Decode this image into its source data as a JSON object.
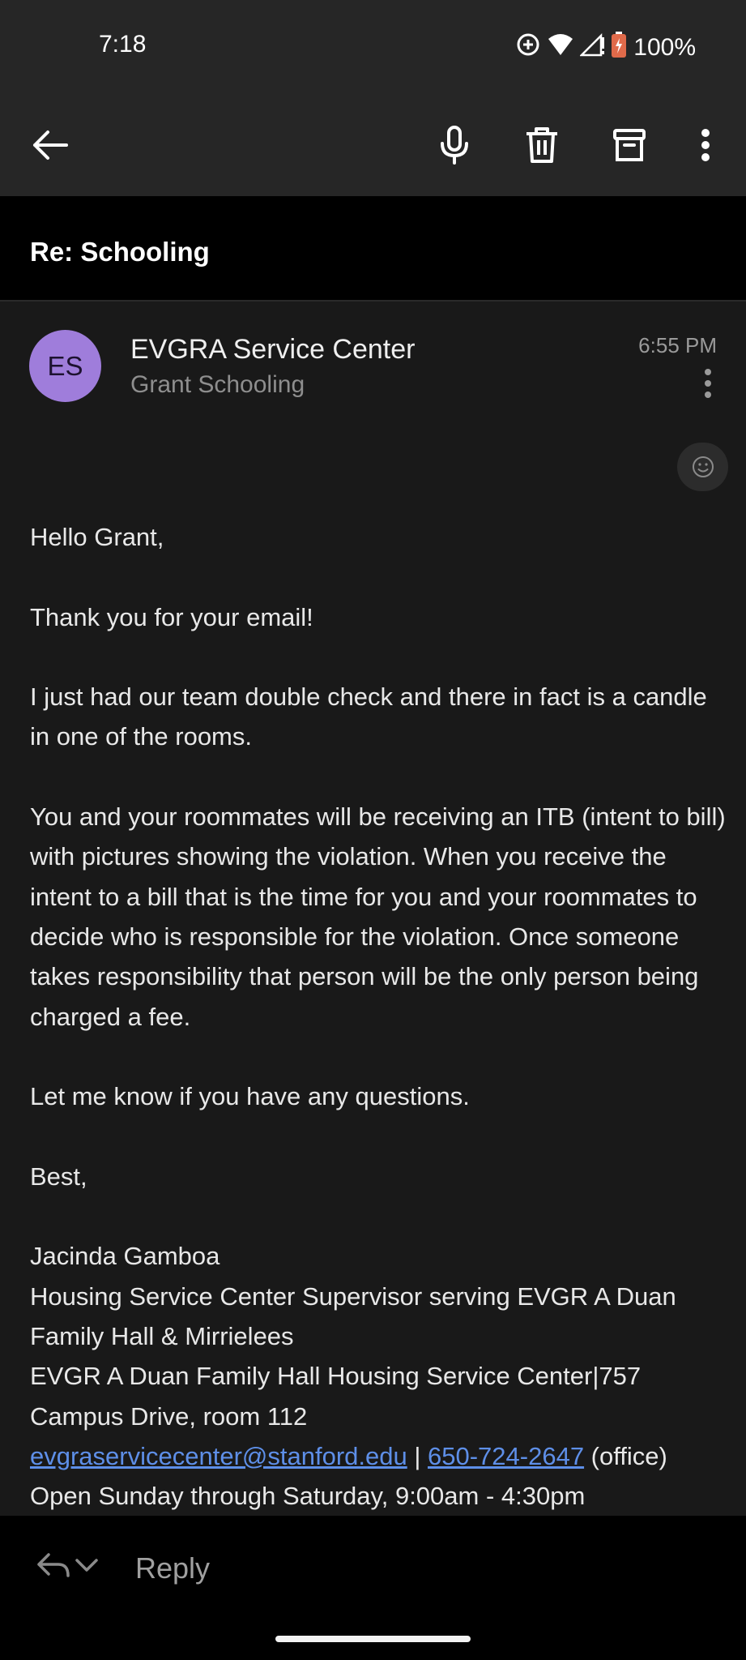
{
  "status_bar": {
    "time": "7:18",
    "battery": "100%",
    "icons": [
      "data-saver-icon",
      "wifi-icon",
      "signal-icon",
      "battery-icon"
    ]
  },
  "toolbar": {
    "icons": [
      "back-arrow-icon",
      "microphone-icon",
      "trash-icon",
      "archive-icon",
      "more-vert-icon"
    ]
  },
  "email": {
    "subject": "Re: Schooling",
    "avatar_initials": "ES",
    "avatar_color": "#9f7ddb",
    "sender": "EVGRA Service Center",
    "recipient": "Grant Schooling",
    "time": "6:55 PM",
    "body": {
      "greeting": "Hello Grant,",
      "p1": "Thank you for your email!",
      "p2": "I just had our team double check and there in fact is a candle in one of the rooms.",
      "p3": "You and your roommates will be receiving an ITB (intent to bill) with pictures showing the violation. When you receive the intent to a bill that is the time for you and your roommates to decide who is responsible for the violation. Once someone takes responsibility that person will be the only person being charged a fee.",
      "p4": "Let me know if you have any questions.",
      "closing": "Best,",
      "sig_name": "Jacinda Gamboa",
      "sig_title": "Housing Service Center Supervisor serving EVGR A Duan Family Hall & Mirrielees",
      "sig_address": "EVGR A Duan Family Hall Housing Service Center|757 Campus Drive, room 112",
      "sig_email": "evgraservicecenter@stanford.edu",
      "sig_separator": " | ",
      "sig_phone": "650-724-2647",
      "sig_phone_note": " (office)",
      "sig_hours": "Open Sunday through Saturday, 9:00am - 4:30pm"
    },
    "link_color": "#5e8fe8"
  },
  "reply_bar": {
    "label": "Reply"
  }
}
